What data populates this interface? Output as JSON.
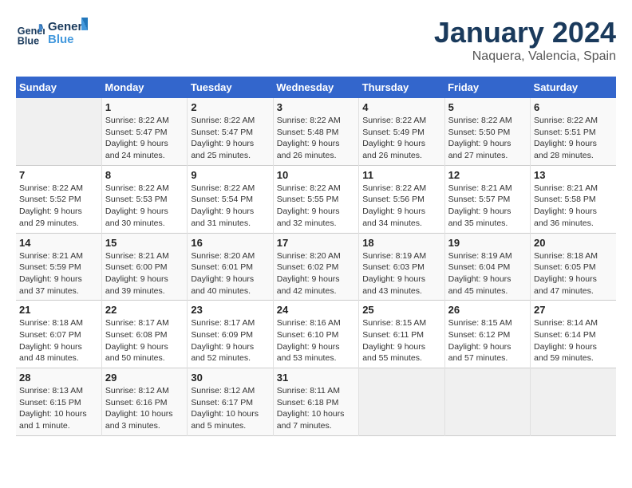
{
  "header": {
    "logo_line1": "General",
    "logo_line2": "Blue",
    "title": "January 2024",
    "subtitle": "Naquera, Valencia, Spain"
  },
  "calendar": {
    "days_of_week": [
      "Sunday",
      "Monday",
      "Tuesday",
      "Wednesday",
      "Thursday",
      "Friday",
      "Saturday"
    ],
    "weeks": [
      [
        {
          "day": "",
          "empty": true
        },
        {
          "day": "1",
          "sunrise": "8:22 AM",
          "sunset": "5:47 PM",
          "daylight": "9 hours and 24 minutes."
        },
        {
          "day": "2",
          "sunrise": "8:22 AM",
          "sunset": "5:47 PM",
          "daylight": "9 hours and 25 minutes."
        },
        {
          "day": "3",
          "sunrise": "8:22 AM",
          "sunset": "5:48 PM",
          "daylight": "9 hours and 26 minutes."
        },
        {
          "day": "4",
          "sunrise": "8:22 AM",
          "sunset": "5:49 PM",
          "daylight": "9 hours and 26 minutes."
        },
        {
          "day": "5",
          "sunrise": "8:22 AM",
          "sunset": "5:50 PM",
          "daylight": "9 hours and 27 minutes."
        },
        {
          "day": "6",
          "sunrise": "8:22 AM",
          "sunset": "5:51 PM",
          "daylight": "9 hours and 28 minutes."
        }
      ],
      [
        {
          "day": "7",
          "sunrise": "8:22 AM",
          "sunset": "5:52 PM",
          "daylight": "9 hours and 29 minutes."
        },
        {
          "day": "8",
          "sunrise": "8:22 AM",
          "sunset": "5:53 PM",
          "daylight": "9 hours and 30 minutes."
        },
        {
          "day": "9",
          "sunrise": "8:22 AM",
          "sunset": "5:54 PM",
          "daylight": "9 hours and 31 minutes."
        },
        {
          "day": "10",
          "sunrise": "8:22 AM",
          "sunset": "5:55 PM",
          "daylight": "9 hours and 32 minutes."
        },
        {
          "day": "11",
          "sunrise": "8:22 AM",
          "sunset": "5:56 PM",
          "daylight": "9 hours and 34 minutes."
        },
        {
          "day": "12",
          "sunrise": "8:21 AM",
          "sunset": "5:57 PM",
          "daylight": "9 hours and 35 minutes."
        },
        {
          "day": "13",
          "sunrise": "8:21 AM",
          "sunset": "5:58 PM",
          "daylight": "9 hours and 36 minutes."
        }
      ],
      [
        {
          "day": "14",
          "sunrise": "8:21 AM",
          "sunset": "5:59 PM",
          "daylight": "9 hours and 37 minutes."
        },
        {
          "day": "15",
          "sunrise": "8:21 AM",
          "sunset": "6:00 PM",
          "daylight": "9 hours and 39 minutes."
        },
        {
          "day": "16",
          "sunrise": "8:20 AM",
          "sunset": "6:01 PM",
          "daylight": "9 hours and 40 minutes."
        },
        {
          "day": "17",
          "sunrise": "8:20 AM",
          "sunset": "6:02 PM",
          "daylight": "9 hours and 42 minutes."
        },
        {
          "day": "18",
          "sunrise": "8:19 AM",
          "sunset": "6:03 PM",
          "daylight": "9 hours and 43 minutes."
        },
        {
          "day": "19",
          "sunrise": "8:19 AM",
          "sunset": "6:04 PM",
          "daylight": "9 hours and 45 minutes."
        },
        {
          "day": "20",
          "sunrise": "8:18 AM",
          "sunset": "6:05 PM",
          "daylight": "9 hours and 47 minutes."
        }
      ],
      [
        {
          "day": "21",
          "sunrise": "8:18 AM",
          "sunset": "6:07 PM",
          "daylight": "9 hours and 48 minutes."
        },
        {
          "day": "22",
          "sunrise": "8:17 AM",
          "sunset": "6:08 PM",
          "daylight": "9 hours and 50 minutes."
        },
        {
          "day": "23",
          "sunrise": "8:17 AM",
          "sunset": "6:09 PM",
          "daylight": "9 hours and 52 minutes."
        },
        {
          "day": "24",
          "sunrise": "8:16 AM",
          "sunset": "6:10 PM",
          "daylight": "9 hours and 53 minutes."
        },
        {
          "day": "25",
          "sunrise": "8:15 AM",
          "sunset": "6:11 PM",
          "daylight": "9 hours and 55 minutes."
        },
        {
          "day": "26",
          "sunrise": "8:15 AM",
          "sunset": "6:12 PM",
          "daylight": "9 hours and 57 minutes."
        },
        {
          "day": "27",
          "sunrise": "8:14 AM",
          "sunset": "6:14 PM",
          "daylight": "9 hours and 59 minutes."
        }
      ],
      [
        {
          "day": "28",
          "sunrise": "8:13 AM",
          "sunset": "6:15 PM",
          "daylight": "10 hours and 1 minute."
        },
        {
          "day": "29",
          "sunrise": "8:12 AM",
          "sunset": "6:16 PM",
          "daylight": "10 hours and 3 minutes."
        },
        {
          "day": "30",
          "sunrise": "8:12 AM",
          "sunset": "6:17 PM",
          "daylight": "10 hours and 5 minutes."
        },
        {
          "day": "31",
          "sunrise": "8:11 AM",
          "sunset": "6:18 PM",
          "daylight": "10 hours and 7 minutes."
        },
        {
          "day": "",
          "empty": true
        },
        {
          "day": "",
          "empty": true
        },
        {
          "day": "",
          "empty": true
        }
      ]
    ],
    "labels": {
      "sunrise": "Sunrise:",
      "sunset": "Sunset:",
      "daylight": "Daylight:"
    }
  }
}
